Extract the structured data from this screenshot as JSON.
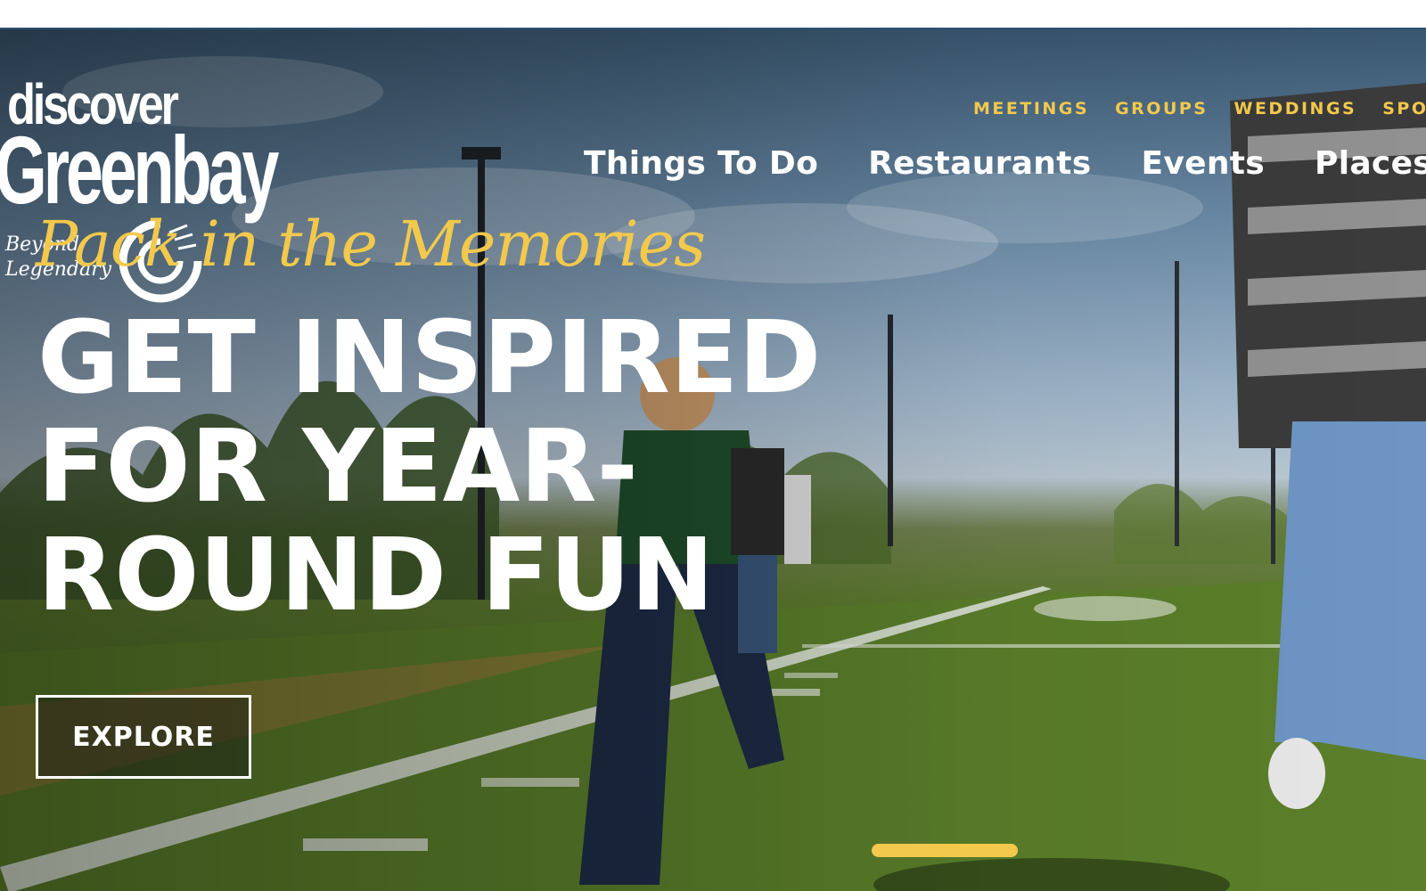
{
  "logo": {
    "line1": "discover",
    "line2": "Greenbay",
    "tagline_line1": "Beyond",
    "tagline_line2": "Legendary"
  },
  "utility_nav": [
    "MEETINGS",
    "GROUPS",
    "WEDDINGS",
    "SPO"
  ],
  "main_nav": [
    "Things To Do",
    "Restaurants",
    "Events",
    "Places T"
  ],
  "hero": {
    "script_tagline": "Pack in the Memories",
    "headline_line1": "GET INSPIRED",
    "headline_line2": "FOR YEAR-",
    "headline_line3": "ROUND FUN",
    "cta_label": "EXPLORE"
  },
  "slider": {
    "active_index": 0
  },
  "colors": {
    "accent_gold": "#f2c94c",
    "text_white": "#ffffff",
    "top_border": "#2c4f73"
  }
}
